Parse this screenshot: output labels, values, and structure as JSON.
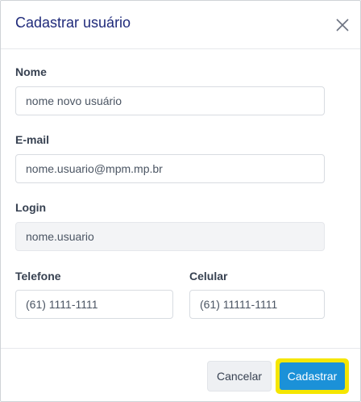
{
  "modal": {
    "title": "Cadastrar usuário",
    "close_icon": "close-icon"
  },
  "fields": {
    "nome": {
      "label": "Nome",
      "value": "nome novo usuário"
    },
    "email": {
      "label": "E-mail",
      "value": "nome.usuario@mpm.mp.br"
    },
    "login": {
      "label": "Login",
      "value": "nome.usuario"
    },
    "telefone": {
      "label": "Telefone",
      "value": "(61) 1111-1111"
    },
    "celular": {
      "label": "Celular",
      "value": "(61) 11111-1111"
    }
  },
  "footer": {
    "cancel_label": "Cancelar",
    "submit_label": "Cadastrar"
  },
  "colors": {
    "title": "#1f2a7a",
    "primary": "#1b91d8",
    "highlight": "#f5e600"
  }
}
